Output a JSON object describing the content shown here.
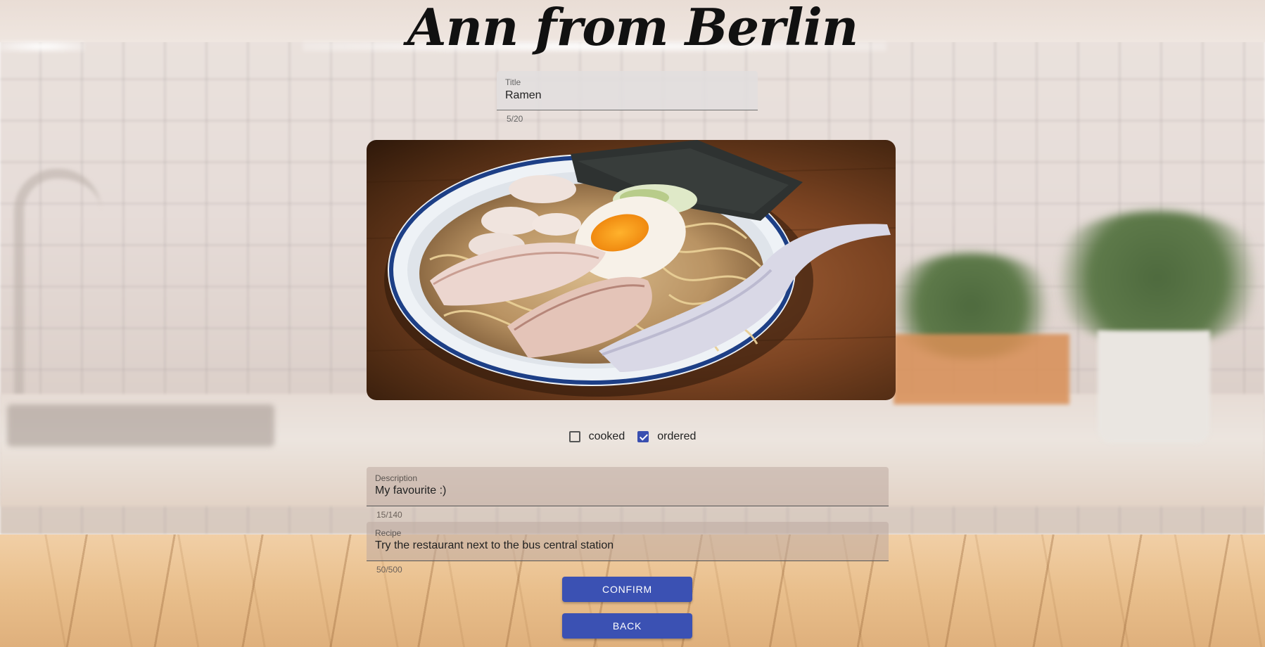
{
  "header": {
    "title": "Ann from Berlin"
  },
  "title_field": {
    "label": "Title",
    "value": "Ramen",
    "counter": "5/20"
  },
  "photo": {
    "alt": "ramen-bowl-photo"
  },
  "options": {
    "cooked": {
      "label": "cooked",
      "checked": false
    },
    "ordered": {
      "label": "ordered",
      "checked": true
    }
  },
  "description_field": {
    "label": "Description",
    "value": "My favourite :)",
    "counter": "15/140"
  },
  "recipe_field": {
    "label": "Recipe",
    "value": "Try the restaurant next to the bus central station",
    "counter": "50/500"
  },
  "actions": {
    "confirm_label": "CONFIRM",
    "back_label": "BACK"
  },
  "colors": {
    "primary": "#3b51b3",
    "title_text": "#111111"
  }
}
